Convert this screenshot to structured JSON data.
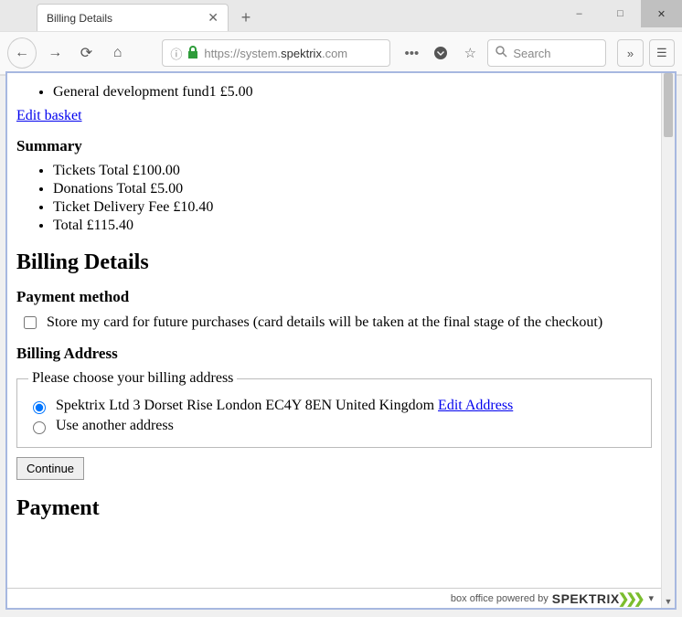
{
  "browser": {
    "tab_title": "Billing Details",
    "url_pre": "https://system.",
    "url_domain": "spektrix",
    "url_post": ".com",
    "search_placeholder": "Search"
  },
  "basket": {
    "items": [
      {
        "label": "General development fund1 £5.00"
      }
    ],
    "edit_link": "Edit basket"
  },
  "summary": {
    "heading": "Summary",
    "lines": [
      "Tickets Total £100.00",
      "Donations Total £5.00",
      "Ticket Delivery Fee £10.40",
      "Total £115.40"
    ]
  },
  "billing": {
    "heading": "Billing Details",
    "payment_method_heading": "Payment method",
    "store_card_label": "Store my card for future purchases (card details will be taken at the final stage of the checkout)",
    "address_heading": "Billing Address",
    "fieldset_legend": "Please choose your billing address",
    "option_existing": "Spektrix Ltd 3 Dorset Rise London EC4Y 8EN United Kingdom ",
    "edit_address_link": "Edit Address",
    "option_other": "Use another address",
    "continue_label": "Continue"
  },
  "payment": {
    "heading": "Payment"
  },
  "footer": {
    "text": "box office powered by",
    "brand": "SPEKTRIX"
  }
}
